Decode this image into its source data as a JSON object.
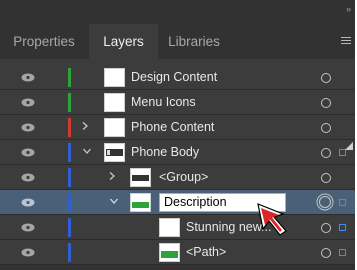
{
  "tabs": [
    {
      "label": "Properties"
    },
    {
      "label": "Layers"
    },
    {
      "label": "Libraries"
    }
  ],
  "active_tab": "Layers",
  "colors": {
    "layer_green": "#2ea33a",
    "layer_red": "#d23b33",
    "layer_blue": "#2f5fd0",
    "selection_square": "#3f8df7",
    "selected_row": "#4a5f78"
  },
  "layers": [
    {
      "name": "Design Content"
    },
    {
      "name": "Menu Icons"
    },
    {
      "name": "Phone Content"
    },
    {
      "name": "Phone Body"
    },
    {
      "name": "<Group>"
    },
    {
      "name": "Description"
    },
    {
      "name": "Stunning new..."
    },
    {
      "name": "<Path>"
    }
  ],
  "rename_value": "Description"
}
